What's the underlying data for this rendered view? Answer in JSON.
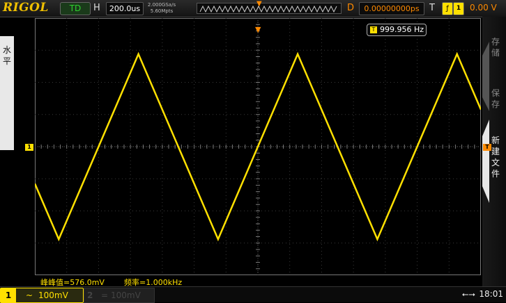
{
  "header": {
    "brand": "RIGOL",
    "run_state": "TD",
    "h_label": "H",
    "timebase": "200.0us",
    "sample_rate": "2.000GSa/s",
    "memory_depth": "5.60Mpts",
    "delay_label": "D",
    "delay_value": "0.00000000ps",
    "trigger_label": "T",
    "trigger_level": "0.00 V"
  },
  "side_menu": {
    "left_label_1": "水",
    "left_label_2": "平"
  },
  "right_menu": {
    "item1_c1": "存",
    "item1_c2": "储",
    "item2_c1": "保",
    "item2_c2": "存",
    "item3_c1": "新",
    "item3_c2": "建",
    "item3_c3": "文",
    "item3_c4": "件"
  },
  "screen": {
    "channel_marker": "1",
    "trigger_marker": "T",
    "frequency": "999.956 Hz",
    "colors": {
      "ch1": "#ffe000",
      "trigger": "#ff8a00",
      "grid": "#3a3a3a"
    }
  },
  "measurements": {
    "vpp": "峰峰值=576.0mV",
    "freq": "频率=1.000kHz"
  },
  "footer": {
    "ch1_num": "1",
    "ch1_coupling": "~",
    "ch1_scale": "100mV",
    "ch2_num": "2",
    "ch2_coupling": "=",
    "ch2_scale": "100mV",
    "usb_icon": "usb-icon",
    "time": "18:01"
  },
  "waveform": {
    "type": "triangle",
    "frequency_hz": 1000,
    "timebase_per_div_us": 200,
    "volts_per_div_mv": 100,
    "vpp_mv": 576
  }
}
